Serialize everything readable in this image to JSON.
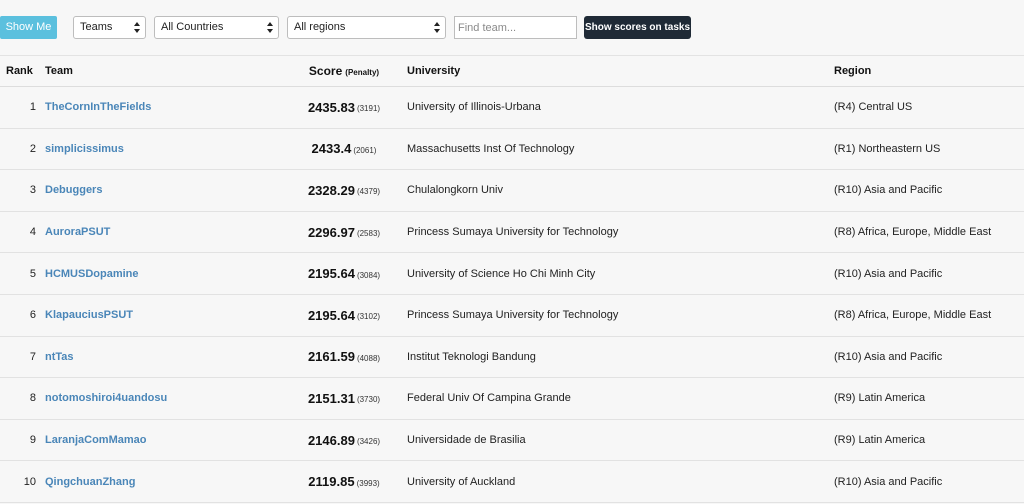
{
  "toolbar": {
    "show_me_label": "Show Me",
    "teams_select": "Teams",
    "countries_select": "All Countries",
    "regions_select": "All regions",
    "find_placeholder": "Find team...",
    "show_scores_label": "Show scores on tasks"
  },
  "table": {
    "headers": {
      "rank": "Rank",
      "team": "Team",
      "score": "Score",
      "penalty": "(Penalty)",
      "university": "University",
      "region": "Region"
    },
    "rows": [
      {
        "rank": "1",
        "team": "TheCornInTheFields",
        "score": "2435.83",
        "penalty": "(3191)",
        "university": "University of Illinois-Urbana",
        "region": "(R4) Central US"
      },
      {
        "rank": "2",
        "team": "simplicissimus",
        "score": "2433.4",
        "penalty": "(2061)",
        "university": "Massachusetts Inst Of Technology",
        "region": "(R1) Northeastern US"
      },
      {
        "rank": "3",
        "team": "Debuggers",
        "score": "2328.29",
        "penalty": "(4379)",
        "university": "Chulalongkorn Univ",
        "region": "(R10) Asia and Pacific"
      },
      {
        "rank": "4",
        "team": "AuroraPSUT",
        "score": "2296.97",
        "penalty": "(2583)",
        "university": "Princess Sumaya University for Technology",
        "region": "(R8) Africa, Europe, Middle East"
      },
      {
        "rank": "5",
        "team": "HCMUSDopamine",
        "score": "2195.64",
        "penalty": "(3084)",
        "university": "University of Science Ho Chi Minh City",
        "region": "(R10) Asia and Pacific"
      },
      {
        "rank": "6",
        "team": "KlapauciusPSUT",
        "score": "2195.64",
        "penalty": "(3102)",
        "university": "Princess Sumaya University for Technology",
        "region": "(R8) Africa, Europe, Middle East"
      },
      {
        "rank": "7",
        "team": "ntTas",
        "score": "2161.59",
        "penalty": "(4088)",
        "university": "Institut Teknologi Bandung",
        "region": "(R10) Asia and Pacific"
      },
      {
        "rank": "8",
        "team": "notomoshiroi4uandosu",
        "score": "2151.31",
        "penalty": "(3730)",
        "university": "Federal Univ Of Campina Grande",
        "region": "(R9) Latin America"
      },
      {
        "rank": "9",
        "team": "LaranjaComMamao",
        "score": "2146.89",
        "penalty": "(3426)",
        "university": "Universidade de Brasilia",
        "region": "(R9) Latin America"
      },
      {
        "rank": "10",
        "team": "QingchuanZhang",
        "score": "2119.85",
        "penalty": "(3993)",
        "university": "University of Auckland",
        "region": "(R10) Asia and Pacific"
      }
    ]
  }
}
